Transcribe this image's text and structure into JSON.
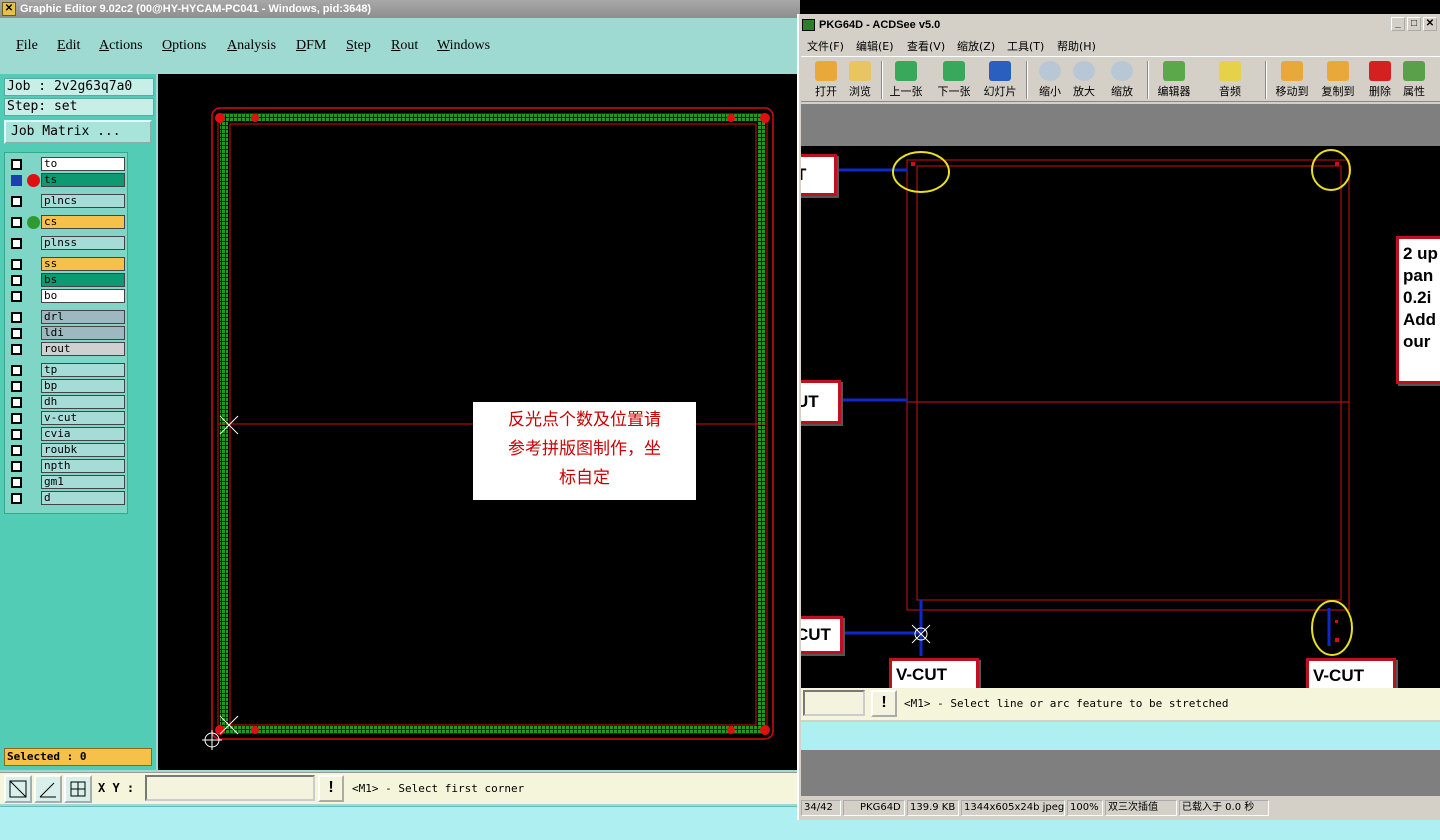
{
  "ge": {
    "title": "Graphic Editor 9.02c2 (00@HY-HYCAM-PC041 - Windows, pid:3648)",
    "menu": [
      "File",
      "Edit",
      "Actions",
      "Options",
      "Analysis",
      "DFM",
      "Step",
      "Rout",
      "Windows"
    ],
    "job": "Job : 2v2g63q7a0",
    "step": "Step: set",
    "job_matrix": "Job Matrix ...",
    "layers": [
      {
        "name": "to",
        "color": "#ffffff"
      },
      {
        "name": "ts",
        "color": "#0d9a73",
        "marker": "#e01010",
        "selected": true
      },
      {
        "name": "plncs",
        "color": "#a6dcd8"
      },
      {
        "name": "cs",
        "color": "#f5c14b",
        "marker": "#2f9a2f"
      },
      {
        "name": "plnss",
        "color": "#a6dcd8"
      },
      {
        "name": "ss",
        "color": "#f5c14b"
      },
      {
        "name": "bs",
        "color": "#0d9a73"
      },
      {
        "name": "bo",
        "color": "#ffffff"
      },
      {
        "name": "drl",
        "color": "#9db8c0"
      },
      {
        "name": "ldi",
        "color": "#9db8c0"
      },
      {
        "name": "rout",
        "color": "#d0d0d0"
      },
      {
        "name": "tp",
        "color": "#a6dcd8"
      },
      {
        "name": "bp",
        "color": "#a6dcd8"
      },
      {
        "name": "dh",
        "color": "#a6dcd8"
      },
      {
        "name": "v-cut",
        "color": "#a6dcd8"
      },
      {
        "name": "cvia",
        "color": "#a6dcd8"
      },
      {
        "name": "roubk",
        "color": "#a6dcd8"
      },
      {
        "name": "npth",
        "color": "#a6dcd8"
      },
      {
        "name": "gm1",
        "color": "#a6dcd8"
      },
      {
        "name": "d",
        "color": "#a6dcd8"
      }
    ],
    "selected": "Selected : 0",
    "xy_label": "X Y :",
    "xy_value": "",
    "excl": "!",
    "message": "<M1> - Select first corner",
    "note_lines": [
      "反光点个数及位置请",
      "参考拼版图制作，坐",
      "标自定"
    ]
  },
  "acd": {
    "title": "PKG64D - ACDSee v5.0",
    "menu": [
      "文件(F)",
      "编辑(E)",
      "查看(V)",
      "缩放(Z)",
      "工具(T)",
      "帮助(H)"
    ],
    "toolbar": [
      "打开",
      "浏览",
      "上一张",
      "下一张",
      "幻灯片",
      "缩小",
      "放大",
      "缩放",
      "编辑器",
      "音频",
      "移动到",
      "复制到",
      "删除",
      "属性"
    ],
    "callouts": [
      "T",
      "UT",
      "CUT",
      "V-CUT",
      "V-CUT"
    ],
    "side_note": [
      "2 up",
      "pan",
      "0.2i",
      "Add",
      "our"
    ],
    "message": "<M1> - Select line or arc feature to be stretched",
    "excl": "!",
    "status": [
      "34/42",
      "PKG64D",
      "139.9 KB",
      "1344x605x24b jpeg",
      "100%",
      "双三次插值",
      "已载入于 0.0 秒"
    ]
  }
}
